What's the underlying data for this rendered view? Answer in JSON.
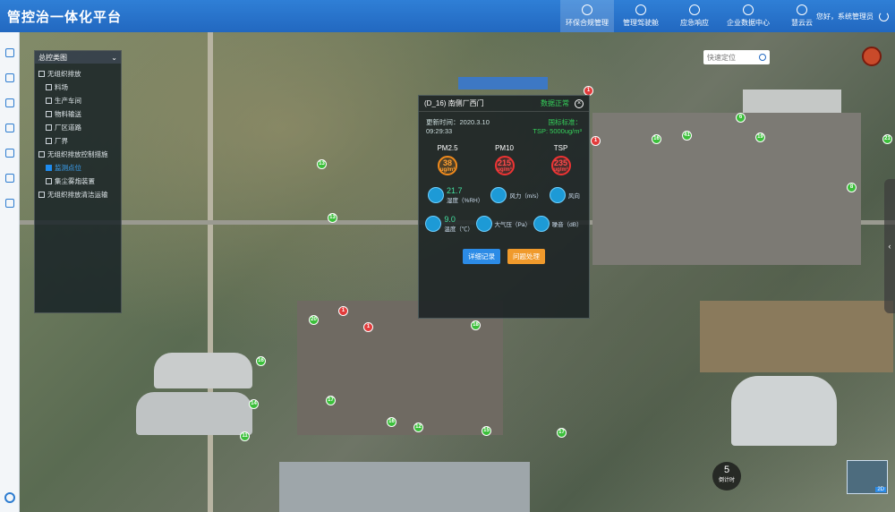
{
  "app": {
    "title": "管控治一体化平台"
  },
  "nav": {
    "items": [
      {
        "label": "环保合规管理",
        "active": true
      },
      {
        "label": "管理驾驶舱",
        "active": false
      },
      {
        "label": "应急响应",
        "active": false
      },
      {
        "label": "企业数据中心",
        "active": false
      },
      {
        "label": "慧云云",
        "active": false
      }
    ],
    "user": "您好，系统管理员"
  },
  "layer_panel": {
    "title": "总控类图",
    "items": [
      {
        "label": "无组织排放",
        "checked": false,
        "sub": false
      },
      {
        "label": "料场",
        "checked": false,
        "sub": true
      },
      {
        "label": "生产车间",
        "checked": false,
        "sub": true
      },
      {
        "label": "物料输送",
        "checked": false,
        "sub": true
      },
      {
        "label": "厂区道路",
        "checked": false,
        "sub": true
      },
      {
        "label": "厂界",
        "checked": false,
        "sub": true
      },
      {
        "label": "无组织排放控制措施",
        "checked": false,
        "sub": false
      },
      {
        "label": "监测点位",
        "checked": true,
        "sub": true
      },
      {
        "label": "集尘雾炮装置",
        "checked": false,
        "sub": true
      },
      {
        "label": "无组织排放清洁运输",
        "checked": false,
        "sub": false
      }
    ]
  },
  "search": {
    "placeholder": "快速定位"
  },
  "popup": {
    "title": "(D_16) 南侧厂西门",
    "status": "数据正常",
    "update_label": "更新时间：2020.3.10",
    "update_time": "09:29:33",
    "standard_label": "国标标准：",
    "standard_value": "TSP: 5000ug/m³",
    "pollutants": [
      {
        "name": "PM2.5",
        "value": "38",
        "unit": "ug/m³",
        "level": "orange"
      },
      {
        "name": "PM10",
        "value": "215",
        "unit": "ug/m³",
        "level": "red"
      },
      {
        "name": "TSP",
        "value": "235",
        "unit": "ug/m³",
        "level": "red"
      }
    ],
    "env": [
      {
        "value": "21.7",
        "label": "湿度（%RH）"
      },
      {
        "value": "",
        "label": "风力（m/s）"
      },
      {
        "value": "",
        "label": "风向"
      },
      {
        "value": "9.0",
        "label": "温度（℃）"
      },
      {
        "value": "",
        "label": "大气压（Pa）"
      },
      {
        "value": "",
        "label": "噪音（dB）"
      }
    ],
    "buttons": {
      "detail": "详细记录",
      "issue": "问题处理"
    }
  },
  "counter": {
    "value": "5",
    "label": "倒计时"
  },
  "minimap": {
    "tag": "2D"
  },
  "markers_green": [
    "13",
    "13",
    "20",
    "16",
    "14",
    "11",
    "17",
    "16",
    "12",
    "18",
    "15",
    "17",
    "16",
    "41",
    "6",
    "19",
    "8",
    "21"
  ],
  "markers_red": [
    "1",
    "1",
    "1",
    "1"
  ]
}
